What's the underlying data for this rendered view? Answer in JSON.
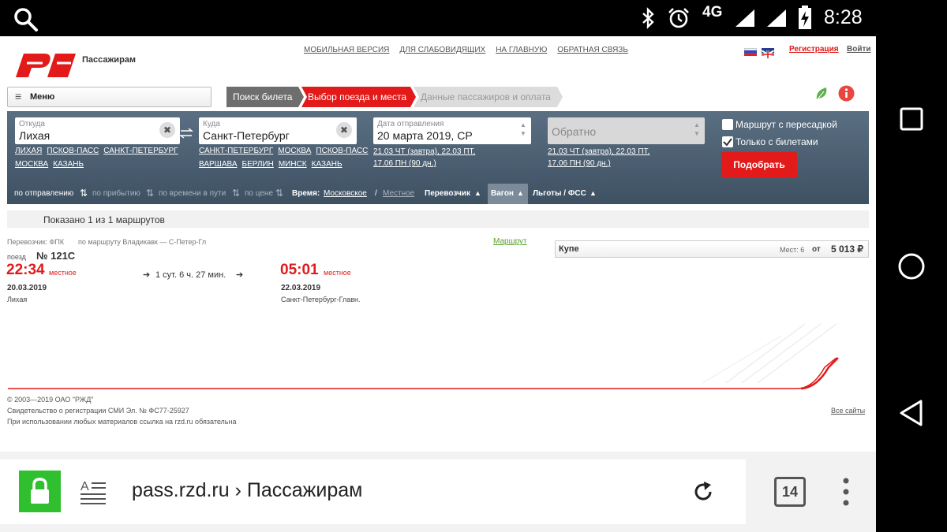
{
  "status": {
    "network": "4G",
    "time": "8:28"
  },
  "site": {
    "logo_text": "РЖД",
    "section": "Пассажирам",
    "links": [
      "МОБИЛЬНАЯ ВЕРСИЯ",
      "ДЛЯ СЛАБОВИДЯЩИХ",
      "НА ГЛАВНУЮ",
      "ОБРАТНАЯ СВЯЗЬ"
    ],
    "register": "Регистрация",
    "login": "Войти",
    "menu": "Меню"
  },
  "steps": [
    "Поиск билета",
    "Выбор поезда и места",
    "Данные пассажиров и оплата"
  ],
  "search": {
    "from_label": "Откуда",
    "from_value": "Лихая",
    "from_quick_row1": [
      "ЛИХАЯ",
      "ПСКОВ-ПАСС",
      "САНКТ-ПЕТЕРБУРГ"
    ],
    "from_quick_row2": [
      "МОСКВА",
      "КАЗАНЬ"
    ],
    "to_label": "Куда",
    "to_value": "Санкт-Петербург",
    "to_quick_row1": [
      "САНКТ-ПЕТЕРБУРГ",
      "МОСКВА",
      "ПСКОВ-ПАСС"
    ],
    "to_quick_row2": [
      "ВАРШАВА",
      "БЕРЛИН",
      "МИНСК",
      "КАЗАНЬ"
    ],
    "date_label": "Дата отправления",
    "date_value": "20 марта 2019, СР",
    "date_hint1": "21.03 ЧТ (завтра), 22.03 ПТ,",
    "date_hint2": "17.06 ПН (90 дн.)",
    "return_placeholder": "Обратно",
    "return_hint1": "21.03 ЧТ (завтра), 22.03 ПТ,",
    "return_hint2": "17.06 ПН (90 дн.)",
    "transfer_label": "Маршрут с пересадкой",
    "tickets_only_label": "Только с билетами",
    "submit": "Подобрать"
  },
  "sort": {
    "by_departure": "по отправлению",
    "by_arrival": "по прибытию",
    "by_travel": "по времени в пути",
    "by_price": "по цене",
    "time_label": "Время:",
    "time_moscow": "Московское",
    "time_local": "Местное",
    "carrier": "Перевозчик",
    "wagon": "Вагон",
    "benefits": "Льготы / ФСС"
  },
  "results": {
    "shown": "Показано 1 из 1 маршрутов",
    "carrier": "Перевозчик: ФПК",
    "route": "по маршруту Владикавк — С-Петер-Гл",
    "route_link": "Маршрут",
    "train_prefix": "поезд",
    "train_number": "№ 121С",
    "dep_time": "22:34",
    "dep_tz": "местное",
    "dep_date": "20.03.2019",
    "dep_station": "Лихая",
    "duration": "1 сут. 6 ч. 27 мин.",
    "arr_time": "05:01",
    "arr_tz": "местное",
    "arr_date": "22.03.2019",
    "arr_station": "Санкт-Петербург-Главн.",
    "class_name": "Купе",
    "seats": "Мест: 6",
    "from_word": "от",
    "price": "5 013 ₽"
  },
  "footer": {
    "copyright": "© 2003—2019  ОАО \"РЖД\"",
    "license": "Свидетельство о регистрации СМИ Эл. № ФС77-25927",
    "notice": "При использовании любых материалов ссылка на rzd.ru обязательна",
    "all_sites": "Все сайты"
  },
  "browser": {
    "url": "pass.rzd.ru › Пассажирам",
    "tab_count": "14"
  },
  "colors": {
    "rzd_red": "#e21a1a",
    "panel": "#4a5d70",
    "lock_green": "#2fbf2f"
  }
}
